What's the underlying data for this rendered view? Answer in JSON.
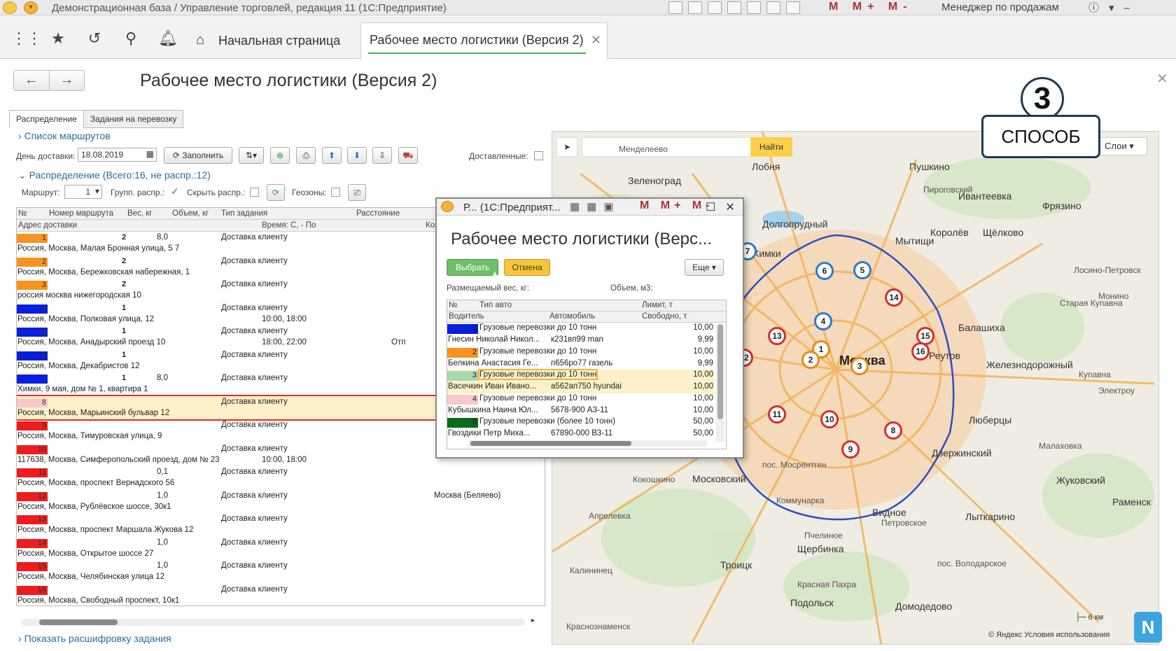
{
  "window": {
    "title": "Демонстрационная база / Управление торговлей, редакция 11  (1С:Предприятие)",
    "user": "Менеджер по продажам",
    "mmm": "M M+ M-"
  },
  "tabs": {
    "home": "Начальная страница",
    "active": "Рабочее место логистики (Версия 2)"
  },
  "page": {
    "title": "Рабочее место логистики (Версия 2)",
    "subtabs": [
      "Распределение",
      "Задания на перевозку"
    ]
  },
  "routes": {
    "header": "Список маршрутов",
    "date_label": "День доставки:",
    "date": "18.08.2019",
    "fill_label": "Заполнить",
    "delivered_label": "Доставленные:"
  },
  "distribution": {
    "header": "Распределение (Всего:16, не распр.:12)",
    "route_label": "Маршрут:",
    "route_value": "1",
    "group_label": "Групп. распр.:",
    "hide_label": "Скрыть распр.:",
    "geo_label": "Геозоны:"
  },
  "grid": {
    "columns": [
      "№",
      "Номер маршрута",
      "Вес, кг",
      "Объем, кг",
      "Тип задания",
      "Расстояние"
    ],
    "columns2": [
      "Адрес доставки",
      "Время: С, - По",
      "Ком"
    ],
    "rows": [
      {
        "n": "1",
        "color": "#f7931e",
        "route": "2",
        "weight": "8,0",
        "type": "Доставка клиенту",
        "addr": "Россия, Москва, Малая Бронная улица, 5 7",
        "time": "",
        "comment": "",
        "dist": ""
      },
      {
        "n": "2",
        "color": "#f7931e",
        "route": "2",
        "weight": "",
        "type": "Доставка клиенту",
        "addr": "Россия, Москва, Бережковская набережная, 1",
        "time": "",
        "comment": "",
        "dist": ""
      },
      {
        "n": "3",
        "color": "#f7931e",
        "route": "2",
        "weight": "",
        "type": "Доставка клиенту",
        "addr": "россия москва нижегородская 10",
        "time": "",
        "comment": "",
        "dist": ""
      },
      {
        "n": "4",
        "color": "#0a1edc",
        "route": "1",
        "weight": "",
        "type": "Доставка клиенту",
        "addr": "Россия, Москва, Полковая улица, 12",
        "time": "10:00, 18:00",
        "comment": "",
        "dist": ""
      },
      {
        "n": "5",
        "color": "#0a1edc",
        "route": "1",
        "weight": "",
        "type": "Доставка клиенту",
        "addr": "Россия, Москва, Анадырский проезд 10",
        "time": "18:00, 22:00",
        "comment": "Отп",
        "dist": ""
      },
      {
        "n": "6",
        "color": "#0a1edc",
        "route": "1",
        "weight": "",
        "type": "Доставка клиенту",
        "addr": "Россия, Москва, Декабристов 12",
        "time": "",
        "comment": "",
        "dist": ""
      },
      {
        "n": "7",
        "color": "#0a1edc",
        "route": "1",
        "weight": "8,0",
        "type": "Доставка клиенту",
        "addr": "Химки, 9 мая, дом № 1, квартира 1",
        "time": "",
        "comment": "",
        "dist": ""
      },
      {
        "n": "8",
        "color": "#f9c9c9",
        "route": "",
        "weight": "",
        "type": "Доставка клиенту",
        "addr": "Россия, Москва, Марьинский бульвар 12",
        "time": "",
        "comment": "",
        "dist": "",
        "selected": true
      },
      {
        "n": "9",
        "color": "#ee1c1c",
        "route": "",
        "weight": "",
        "type": "Доставка клиенту",
        "addr": "Россия, Москва, Тимуровская улица, 9",
        "time": "",
        "comment": "",
        "dist": ""
      },
      {
        "n": "10",
        "color": "#ee1c1c",
        "route": "",
        "weight": "",
        "type": "Доставка клиенту",
        "addr": "117638, Москва, Симферопольский проезд, дом № 23",
        "time": "10:00, 18:00",
        "comment": "",
        "dist": ""
      },
      {
        "n": "11",
        "color": "#ee1c1c",
        "route": "",
        "weight": "0,1",
        "type": "Доставка клиенту",
        "addr": "Россия, Москва, проспект Вернадского 56",
        "time": "",
        "comment": "",
        "dist": ""
      },
      {
        "n": "12",
        "color": "#ee1c1c",
        "route": "",
        "weight": "1,0",
        "type": "Доставка клиенту",
        "addr": "Россия, Москва, Рублёвское шоссе, 30к1",
        "time": "",
        "comment": "",
        "dist": "Москва (Беляево)"
      },
      {
        "n": "13",
        "color": "#ee1c1c",
        "route": "",
        "weight": "",
        "type": "Доставка клиенту",
        "addr": "Россия, Москва, проспект Маршала Жукова 12",
        "time": "",
        "comment": "",
        "dist": ""
      },
      {
        "n": "14",
        "color": "#ee1c1c",
        "route": "",
        "weight": "1,0",
        "type": "Доставка клиенту",
        "addr": "Россия, Москва, Открытое шоссе 27",
        "time": "",
        "comment": "",
        "dist": ""
      },
      {
        "n": "15",
        "color": "#ee1c1c",
        "route": "",
        "weight": "1,0",
        "type": "Доставка клиенту",
        "addr": "Россия, Москва, Челябинская улица 12",
        "time": "",
        "comment": "",
        "dist": ""
      },
      {
        "n": "16",
        "color": "#ee1c1c",
        "route": "",
        "weight": "",
        "type": "Доставка клиенту",
        "addr": "Россия, Москва, Свободный проспект, 10к1",
        "time": "",
        "comment": "",
        "dist": ""
      }
    ],
    "decode_link": "Показать расшифровку задания"
  },
  "map": {
    "find_label": "Найти",
    "layers_label": "Слои",
    "labels": [
      "Менделеево",
      "Лобня",
      "Пушкино",
      "Зеленоград",
      "Пироговский",
      "Ивантеевка",
      "Фрязино",
      "Долгопрудный",
      "Мытищи",
      "Королёв",
      "Щёлково",
      "Химки",
      "Лосино-Петровск",
      "Монино",
      "Старая Купавна",
      "Балашиха",
      "Реутов",
      "Железнодорожный",
      "Купавна",
      "Электроу",
      "Люберцы",
      "Малаховка",
      "Дзержинский",
      "Москва",
      "пос. Мосрентген",
      "Московский",
      "Кокошкино",
      "Апрелевка",
      "Коммунарка",
      "Лыткарино",
      "Жуковский",
      "Раменск",
      "Видное",
      "Петровское",
      "Щербинка",
      "Пчелиное",
      "Троицк",
      "пос. Володарское",
      "Домодедово",
      "Подольск",
      "Калининец",
      "Красная Пахра",
      "Краснознаменск"
    ],
    "copyright": "© Яндекс Условия использования",
    "scale": "6 км",
    "pins": [
      "1",
      "2",
      "3",
      "4",
      "5",
      "6",
      "7",
      "8",
      "9",
      "10",
      "11",
      "12",
      "13",
      "14",
      "15",
      "16"
    ]
  },
  "stamp": {
    "number": "3",
    "text": "СПОСОБ"
  },
  "dialog": {
    "title": "Р... (1С:Предприят...",
    "heading": "Рабочее место логистики (Верс...",
    "select_label": "Выбрать",
    "cancel_label": "Отмена",
    "more_label": "Еще",
    "weight_label": "Размещаемый вес, кг:",
    "volume_label": "Объем, м3:",
    "columns": [
      "№",
      "Тип авто",
      "Лимит, т"
    ],
    "columns2": [
      "Водитель",
      "Автомобиль",
      "Свободно, т"
    ],
    "rows": [
      {
        "n": "1",
        "color": "#0a1edc",
        "type": "Грузовые перевозки до 10 тонн",
        "limit": "10,00",
        "driver": "Гнесин Николай Никол...",
        "car": "к231вп99 man",
        "free": "9,99"
      },
      {
        "n": "2",
        "color": "#f7931e",
        "type": "Грузовые перевозки до 10 тонн",
        "limit": "10,00",
        "driver": "Белкина Анастасия Ге...",
        "car": "п656ро77 газель",
        "free": "9,99"
      },
      {
        "n": "3",
        "color": "#a9d8b0",
        "type": "Грузовые перевозки до 10 тонн",
        "limit": "10,00",
        "driver": "Васечкин Иван Ивано...",
        "car": "а562ап750 hyundai",
        "free": "10,00",
        "selected": true
      },
      {
        "n": "4",
        "color": "#f9c9c9",
        "type": "Грузовые перевозки до 10 тонн",
        "limit": "10,00",
        "driver": "Кубышкина Наина Юл...",
        "car": "5678-900 АЗ-11",
        "free": "10,00"
      },
      {
        "n": "5",
        "color": "#0a6b1a",
        "type": "Грузовые перевозки (более 10 тонн)",
        "limit": "50,00",
        "driver": "Гвоздики Петр Миха...",
        "car": "67890-000 ВЗ-11",
        "free": "50,00"
      }
    ]
  }
}
